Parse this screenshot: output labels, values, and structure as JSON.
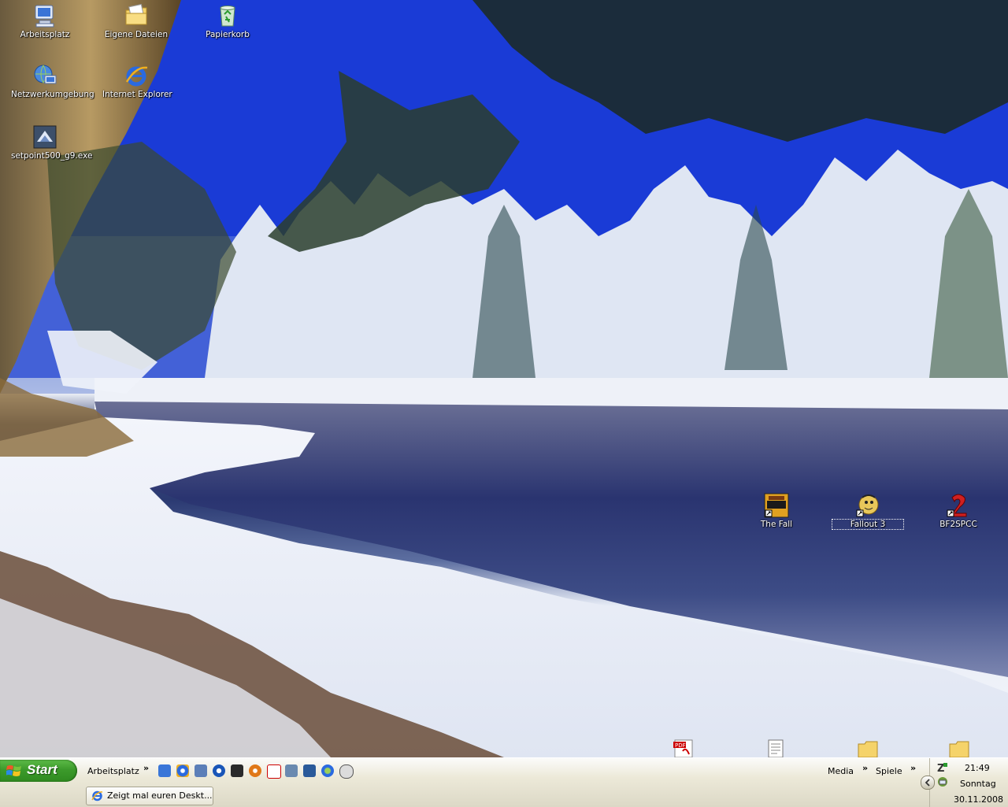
{
  "desktop_icons": [
    {
      "label": "Arbeitsplatz",
      "icon": "my-computer-icon"
    },
    {
      "label": "Eigene Dateien",
      "icon": "my-documents-icon"
    },
    {
      "label": "Papierkorb",
      "icon": "recycle-bin-icon"
    },
    {
      "label": "Netzwerkumgebung",
      "icon": "network-places-icon"
    },
    {
      "label": "Internet Explorer",
      "icon": "internet-explorer-icon"
    },
    {
      "label": "setpoint500_g9.exe",
      "icon": "installer-exe-icon"
    },
    {
      "label": "The Fall",
      "icon": "the-fall-game-icon"
    },
    {
      "label": "Fallout 3",
      "icon": "fallout3-game-icon"
    },
    {
      "label": "BF2SPCC",
      "icon": "bf2spcc-icon"
    }
  ],
  "taskbar": {
    "start_label": "Start",
    "toolbar_label": "Arbeitsplatz",
    "chevron": "»",
    "media_label": "Media",
    "games_label": "Spiele",
    "task_button_label": "Zeigt mal euren Deskt..."
  },
  "clock": {
    "time": "21:49",
    "day": "Sonntag",
    "date": "30.11.2008"
  },
  "colors": {
    "start_green": "#3c9a2b",
    "taskbar": "#ece9d8",
    "sky": "#1635d8"
  }
}
